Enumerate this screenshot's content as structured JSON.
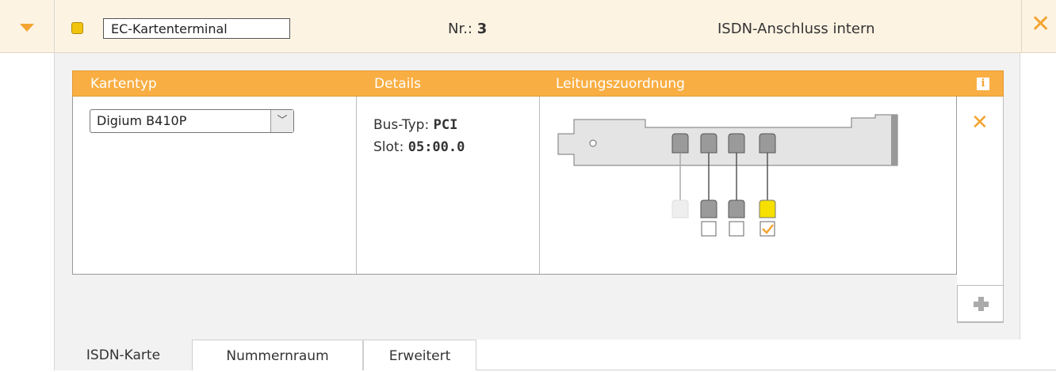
{
  "header": {
    "name_value": "EC-Kartenterminal",
    "nr_label": "Nr.:",
    "nr_value": "3",
    "type_title": "ISDN-Anschluss intern",
    "status_color": "#f1c40f"
  },
  "table": {
    "headers": [
      "Kartentyp",
      "Details",
      "Leitungszuordnung"
    ],
    "card_type_selected": "Digium B410P",
    "details": {
      "bus_label": "Bus-Typ:",
      "bus_value": "PCI",
      "slot_label": "Slot:",
      "slot_value": "05:00.0"
    },
    "ports": [
      {
        "state": "inactive",
        "checked": null
      },
      {
        "state": "available",
        "checked": false
      },
      {
        "state": "available",
        "checked": false
      },
      {
        "state": "assigned",
        "checked": true
      }
    ]
  },
  "icons": {
    "collapse": "chevron-down-icon",
    "close": "close-icon",
    "info": "info-icon",
    "delete": "delete-icon",
    "add": "add-icon"
  },
  "tabs": [
    "ISDN-Karte",
    "Nummernraum",
    "Erweitert"
  ],
  "active_tab": "ISDN-Karte",
  "colors": {
    "accent": "#f9ae43",
    "port_assigned": "#f5e000"
  }
}
